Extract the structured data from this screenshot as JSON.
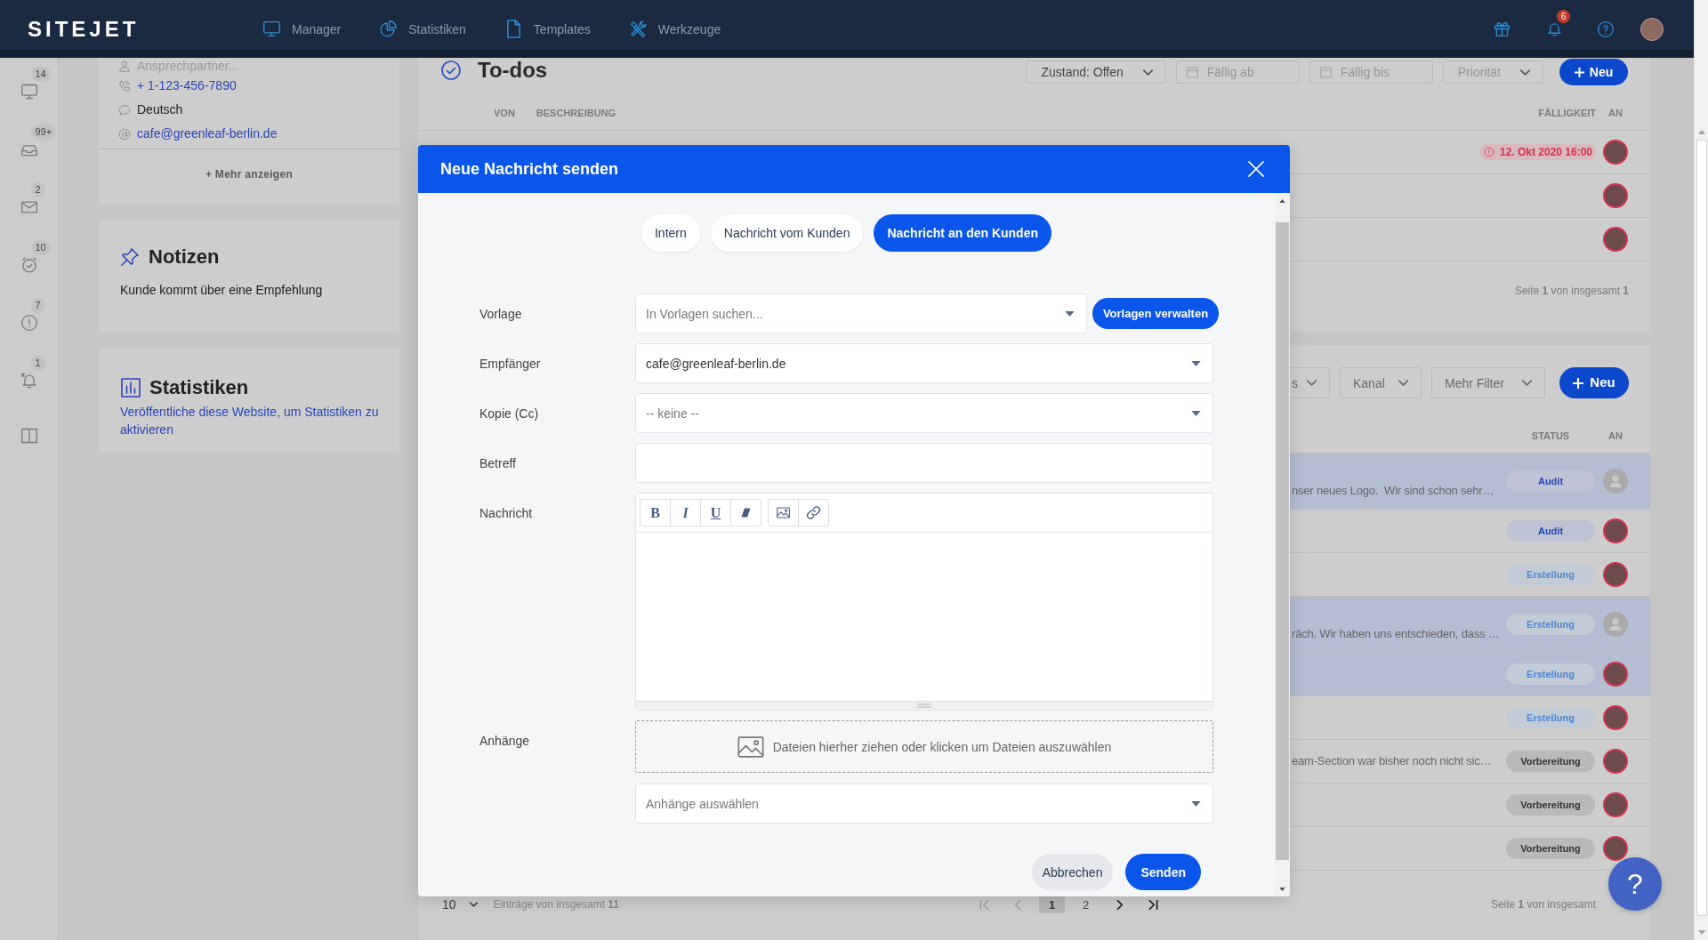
{
  "topbar": {
    "logo": "SITEJET",
    "nav": [
      {
        "label": "Manager"
      },
      {
        "label": "Statistiken"
      },
      {
        "label": "Templates"
      },
      {
        "label": "Werkzeuge"
      }
    ],
    "notifications_badge": "6"
  },
  "sidebar": {
    "items": [
      {
        "badge": "14"
      },
      {
        "badge": "99+"
      },
      {
        "badge": "2"
      },
      {
        "badge": "10"
      },
      {
        "badge": "7"
      },
      {
        "badge": "1"
      }
    ]
  },
  "contact_card": {
    "rows": [
      {
        "kind": "placeholder",
        "text": "Ansprechpartner..."
      },
      {
        "kind": "link",
        "text": "+ 1-123-456-7890"
      },
      {
        "kind": "plain",
        "text": "Deutsch"
      },
      {
        "kind": "link",
        "text": "cafe@greenleaf-berlin.de"
      }
    ],
    "more_link": "+ Mehr anzeigen"
  },
  "notes_card": {
    "title": "Notizen",
    "text": "Kunde kommt über eine Empfehlung"
  },
  "stats_card": {
    "title": "Statistiken",
    "link": "Veröffentliche diese Website, um Statistiken zu aktivieren"
  },
  "todos": {
    "title": "To-dos",
    "filters": [
      {
        "kind": "select",
        "value": "Zustand: Offen"
      },
      {
        "kind": "date",
        "placeholder": "Fällig ab"
      },
      {
        "kind": "date",
        "placeholder": "Fällig bis"
      },
      {
        "kind": "select",
        "placeholder": "Priorität"
      }
    ],
    "new_button": "Neu",
    "columns": [
      "VON",
      "BESCHREIBUNG",
      "FÄLLIGKEIT",
      "AN"
    ],
    "rows": [
      {
        "due": "12. Okt 2020 16:00",
        "avatar": {
          "kind": "photo"
        }
      },
      {
        "avatar": {
          "kind": "photo"
        }
      },
      {
        "avatar": {
          "kind": "photo"
        }
      }
    ],
    "pager": "Seite **1** von insgesamt **1**"
  },
  "tickets": {
    "filters": [
      {
        "label": "s"
      },
      {
        "label": "Kanal"
      },
      {
        "label": "Mehr Filter"
      }
    ],
    "new_button": "Neu",
    "columns": [
      "STATUS",
      "AN"
    ],
    "rows": [
      {
        "kind": "two_line",
        "text": "nser neues Logo.  Wir sind schon sehr…",
        "highlighted": true,
        "status": {
          "label": "Audit",
          "kind": "audit"
        },
        "avatar": {
          "kind": "placeholder"
        }
      },
      {
        "kind": "one_line",
        "highlighted": false,
        "status": {
          "label": "Audit",
          "kind": "audit"
        },
        "avatar": {
          "kind": "photo"
        }
      },
      {
        "kind": "one_line",
        "highlighted": false,
        "status": {
          "label": "Erstellung",
          "kind": "creation"
        },
        "avatar": {
          "kind": "photo"
        }
      },
      {
        "kind": "two_line",
        "text": "räch. Wir haben uns entschieden, dass …",
        "highlighted": true,
        "status": {
          "label": "Erstellung",
          "kind": "creation"
        },
        "avatar": {
          "kind": "placeholder"
        }
      },
      {
        "kind": "one_line",
        "highlighted": true,
        "status": {
          "label": "Erstellung",
          "kind": "creation"
        },
        "avatar": {
          "kind": "photo"
        }
      },
      {
        "kind": "one_line",
        "highlighted": false,
        "status": {
          "label": "Erstellung",
          "kind": "creation"
        },
        "avatar": {
          "kind": "photo"
        }
      },
      {
        "kind": "one_line",
        "text": "eam-Section war bisher noch nicht sic…",
        "highlighted": false,
        "status": {
          "label": "Vorbereitung",
          "kind": "preparation"
        },
        "avatar": {
          "kind": "photo"
        }
      },
      {
        "kind": "one_line",
        "highlighted": false,
        "status": {
          "label": "Vorbereitung",
          "kind": "preparation"
        },
        "avatar": {
          "kind": "photo"
        }
      },
      {
        "kind": "one_line",
        "highlighted": false,
        "status": {
          "label": "Vorbereitung",
          "kind": "preparation"
        },
        "avatar": {
          "kind": "photo"
        }
      }
    ],
    "page_size": "10",
    "entries": "Einträge von insgesamt **11**",
    "page_nav": [
      {
        "kind": "first",
        "disabled": true
      },
      {
        "kind": "previous",
        "disabled": true
      },
      {
        "kind": "next",
        "disabled": false
      },
      {
        "kind": "last",
        "disabled": false
      }
    ],
    "pages": [
      {
        "label": "1",
        "selected": true
      },
      {
        "label": "2",
        "selected": false
      }
    ],
    "pager": "Seite **1** von insgesamt"
  },
  "modal": {
    "title": "Neue Nachricht senden",
    "tabs": [
      {
        "label": "Intern",
        "selected": false
      },
      {
        "label": "Nachricht vom Kunden",
        "selected": false
      },
      {
        "label": "Nachricht an den Kunden",
        "selected": true
      }
    ],
    "fields": [
      {
        "kind": "select",
        "label": "Vorlage",
        "placeholder": "In Vorlagen suchen...",
        "button": "Vorlagen verwalten"
      },
      {
        "kind": "select",
        "label": "Empfänger",
        "value": "cafe@greenleaf-berlin.de"
      },
      {
        "kind": "select",
        "label": "Kopie (Cc)",
        "placeholder": "-- keine --"
      },
      {
        "kind": "text",
        "label": "Betreff"
      },
      {
        "kind": "editor",
        "label": "Nachricht",
        "toolbar": [
          [
            {
              "kind": "bold",
              "label": "B"
            },
            {
              "kind": "italic",
              "label": "I"
            },
            {
              "kind": "underline",
              "label": "U"
            },
            {
              "kind": "clear"
            }
          ],
          [
            {
              "kind": "image"
            },
            {
              "kind": "link"
            }
          ]
        ]
      },
      {
        "kind": "attachments",
        "label": "Anhänge",
        "dropzone": "Dateien hierher ziehen oder klicken um Dateien auszuwählen",
        "placeholder": "Anhänge auswählen"
      }
    ],
    "buttons": [
      {
        "label": "Abbrechen",
        "kind": "secondary"
      },
      {
        "label": "Senden",
        "kind": "primary"
      }
    ]
  },
  "help_button": "?"
}
